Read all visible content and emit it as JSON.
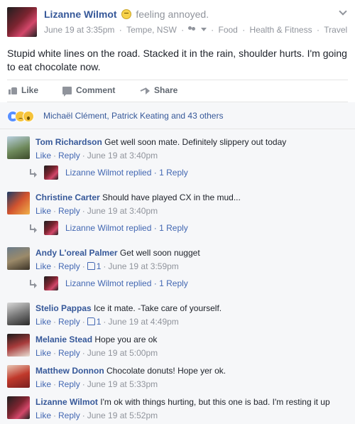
{
  "post": {
    "author": "Lizanne Wilmot",
    "feeling": "feeling annoyed.",
    "date": "June 19 at 3:35pm",
    "location": "Tempe, NSW",
    "tags": [
      "Food",
      "Health & Fitness",
      "Travel"
    ],
    "text": "Stupid white lines on the road. Stacked it in the rain, shoulder hurts. I'm going to eat chocolate now.",
    "actions": {
      "like": "Like",
      "comment": "Comment",
      "share": "Share"
    },
    "reactions_text": "Michaël Clément, Patrick Keating and 43 others"
  },
  "labels": {
    "like": "Like",
    "reply": "Reply",
    "dot": "·"
  },
  "comments": [
    {
      "name": "Tom Richardson",
      "text": "Get well soon mate. Definitely slippery out today",
      "time": "June 19 at 3:40pm",
      "likes": "",
      "reply": {
        "name": "Lizanne Wilmot",
        "verb": "replied",
        "count": "1 Reply"
      }
    },
    {
      "name": "Christine Carter",
      "text": "Should have played CX in the mud...",
      "time": "June 19 at 3:40pm",
      "likes": "",
      "reply": {
        "name": "Lizanne Wilmot",
        "verb": "replied",
        "count": "1 Reply"
      }
    },
    {
      "name": "Andy L'oreal Palmer",
      "text": "Get well soon nugget",
      "time": "June 19 at 3:59pm",
      "likes": "1",
      "reply": {
        "name": "Lizanne Wilmot",
        "verb": "replied",
        "count": "1 Reply"
      }
    },
    {
      "name": "Stelio Pappas",
      "text": "Ice it mate. -Take care of yourself.",
      "time": "June 19 at 4:49pm",
      "likes": "1"
    },
    {
      "name": "Melanie Stead",
      "text": "Hope you are ok",
      "time": "June 19 at 5:00pm",
      "likes": ""
    },
    {
      "name": "Matthew Donnon",
      "text": "Chocolate donuts! Hope yer ok.",
      "time": "June 19 at 5:33pm",
      "likes": ""
    },
    {
      "name": "Lizanne Wilmot",
      "text": "I'm ok with things hurting, but this one is bad. I'm resting it up",
      "time": "June 19 at 5:52pm",
      "likes": ""
    }
  ],
  "colors": {
    "link": "#365899",
    "meta": "#90949c",
    "panel": "#f6f7f9"
  }
}
